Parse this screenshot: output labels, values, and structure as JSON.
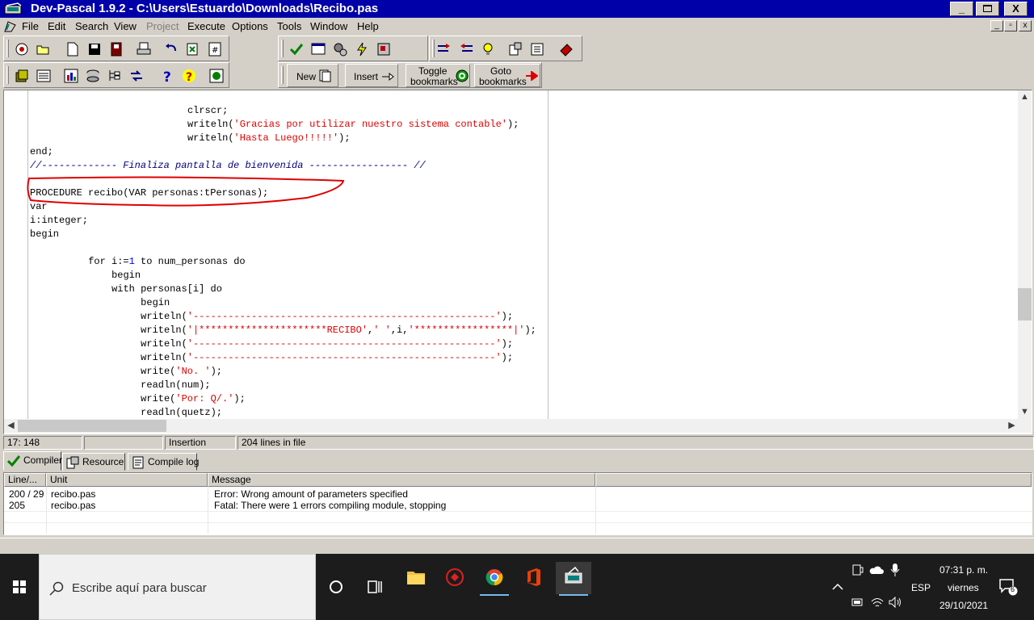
{
  "window": {
    "title": "Dev-Pascal 1.9.2 - C:\\Users\\Estuardo\\Downloads\\Recibo.pas",
    "controls": {
      "minimize": "_",
      "maximize": "□",
      "close": "X"
    }
  },
  "menu": {
    "items": [
      "File",
      "Edit",
      "Search",
      "View",
      "Project",
      "Execute",
      "Options",
      "Tools",
      "Window",
      "Help"
    ],
    "disabled": [
      "Project"
    ]
  },
  "toolbar": {
    "new_label": "New",
    "insert_label": "Insert",
    "toggle_label_1": "Toggle",
    "toggle_label_2": "bookmarks",
    "goto_label_1": "Goto",
    "goto_label_2": "bookmarks"
  },
  "editor": {
    "lines": [
      {
        "indent": 27,
        "parts": [
          {
            "t": "clrscr;",
            "c": "kw"
          }
        ]
      },
      {
        "indent": 27,
        "parts": [
          {
            "t": "writeln(",
            "c": "kw"
          },
          {
            "t": "'Gracias por utilizar nuestro sistema contable'",
            "c": "str"
          },
          {
            "t": ");",
            "c": "kw"
          }
        ]
      },
      {
        "indent": 27,
        "parts": [
          {
            "t": "writeln(",
            "c": "kw"
          },
          {
            "t": "'Hasta Luego!!!!!'",
            "c": "str"
          },
          {
            "t": ");",
            "c": "kw"
          }
        ]
      },
      {
        "indent": 0,
        "parts": [
          {
            "t": "end;",
            "c": "kw"
          }
        ]
      },
      {
        "indent": 0,
        "parts": [
          {
            "t": "//------------- Finaliza pantalla de bienvenida ----------------- //",
            "c": "cmt"
          }
        ]
      },
      {
        "indent": 0,
        "parts": [
          {
            "t": "",
            "c": "kw"
          }
        ]
      },
      {
        "indent": 0,
        "parts": [
          {
            "t": "PROCEDURE recibo(VAR personas:tPersonas);",
            "c": "kw"
          }
        ]
      },
      {
        "indent": 0,
        "parts": [
          {
            "t": "var",
            "c": "kw"
          }
        ]
      },
      {
        "indent": 0,
        "parts": [
          {
            "t": "i:integer;",
            "c": "kw"
          }
        ]
      },
      {
        "indent": 0,
        "parts": [
          {
            "t": "begin",
            "c": "kw"
          }
        ]
      },
      {
        "indent": 0,
        "parts": [
          {
            "t": "",
            "c": "kw"
          }
        ]
      },
      {
        "indent": 10,
        "parts": [
          {
            "t": "for i:=",
            "c": "kw"
          },
          {
            "t": "1",
            "c": "num"
          },
          {
            "t": " to num_personas do",
            "c": "kw"
          }
        ]
      },
      {
        "indent": 14,
        "parts": [
          {
            "t": "begin",
            "c": "kw"
          }
        ]
      },
      {
        "indent": 14,
        "parts": [
          {
            "t": "with personas[i] do",
            "c": "kw"
          }
        ]
      },
      {
        "indent": 19,
        "parts": [
          {
            "t": "begin",
            "c": "kw"
          }
        ]
      },
      {
        "indent": 19,
        "parts": [
          {
            "t": "writeln(",
            "c": "kw"
          },
          {
            "t": "'----------------------------------------------------'",
            "c": "str"
          },
          {
            "t": ");",
            "c": "kw"
          }
        ]
      },
      {
        "indent": 19,
        "parts": [
          {
            "t": "writeln(",
            "c": "kw"
          },
          {
            "t": "'|**********************RECIBO'",
            "c": "str"
          },
          {
            "t": ",",
            "c": "kw"
          },
          {
            "t": "' '",
            "c": "str"
          },
          {
            "t": ",i,",
            "c": "kw"
          },
          {
            "t": "'*****************|'",
            "c": "str"
          },
          {
            "t": ");",
            "c": "kw"
          }
        ]
      },
      {
        "indent": 19,
        "parts": [
          {
            "t": "writeln(",
            "c": "kw"
          },
          {
            "t": "'----------------------------------------------------'",
            "c": "str"
          },
          {
            "t": ");",
            "c": "kw"
          }
        ]
      },
      {
        "indent": 19,
        "parts": [
          {
            "t": "writeln(",
            "c": "kw"
          },
          {
            "t": "'----------------------------------------------------'",
            "c": "str"
          },
          {
            "t": ");",
            "c": "kw"
          }
        ]
      },
      {
        "indent": 19,
        "parts": [
          {
            "t": "write(",
            "c": "kw"
          },
          {
            "t": "'No. '",
            "c": "str"
          },
          {
            "t": ");",
            "c": "kw"
          }
        ]
      },
      {
        "indent": 19,
        "parts": [
          {
            "t": "readln(num);",
            "c": "kw"
          }
        ]
      },
      {
        "indent": 19,
        "parts": [
          {
            "t": "write(",
            "c": "kw"
          },
          {
            "t": "'Por: Q/.'",
            "c": "str"
          },
          {
            "t": ");",
            "c": "kw"
          }
        ]
      },
      {
        "indent": 19,
        "parts": [
          {
            "t": "readln(quetz);",
            "c": "kw"
          }
        ]
      }
    ],
    "highlight_line_index": 6
  },
  "status": {
    "position": "17: 148",
    "mode": "Insertion",
    "line_count": "204 lines in file"
  },
  "tabs": [
    {
      "label": "Compiler",
      "icon": "check-icon"
    },
    {
      "label": "Resource",
      "icon": "resource-icon"
    },
    {
      "label": "Compile log",
      "icon": "log-icon"
    }
  ],
  "results": {
    "headers": [
      "Line/...",
      "Unit",
      "Message"
    ],
    "rows": [
      {
        "line": "200 / 29",
        "unit": "recibo.pas",
        "message": "Error: Wrong amount of parameters specified"
      },
      {
        "line": "205",
        "unit": "recibo.pas",
        "message": "Fatal: There were 1 errors compiling module, stopping"
      }
    ]
  },
  "taskbar": {
    "search_placeholder": "Escribe aquí para buscar",
    "language": "ESP",
    "time": "07:31 p. m.",
    "day": "viernes",
    "date": "29/10/2021",
    "notification_count": "6"
  },
  "colors": {
    "title_bar": "#0000a8",
    "string": "#e00000",
    "comment": "#000080",
    "number": "#0000ff",
    "annotation": "#e00000"
  }
}
